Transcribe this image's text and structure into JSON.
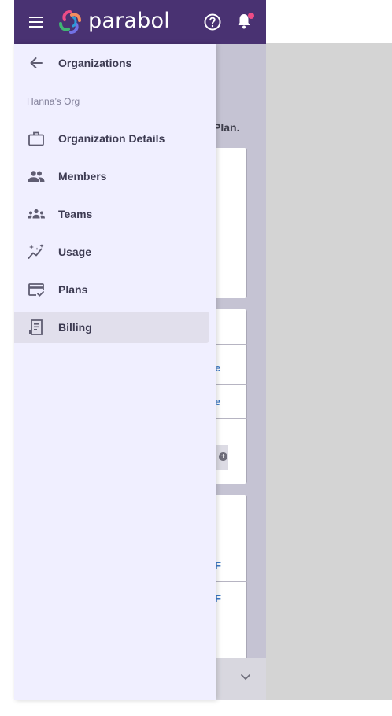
{
  "topbar": {
    "brand": "parabol",
    "menu_icon": "hamburger-menu-icon",
    "help_icon": "help-circle-icon",
    "notifications_icon": "bell-icon",
    "accent": "#493272",
    "notification_dot_color": "#ed4c86"
  },
  "sidebar": {
    "back_label": "Organizations",
    "org_name": "Hanna’s Org",
    "items": [
      {
        "label": "Organization Details",
        "icon": "briefcase-icon"
      },
      {
        "label": "Members",
        "icon": "people-icon"
      },
      {
        "label": "Teams",
        "icon": "groups-icon"
      },
      {
        "label": "Usage",
        "icon": "sparkle-chart-icon"
      },
      {
        "label": "Plans",
        "icon": "card-check-icon"
      },
      {
        "label": "Billing",
        "icon": "receipt-icon",
        "active": true
      }
    ]
  },
  "background": {
    "plan_text": "Plan.",
    "links": [
      "e",
      "e",
      "F",
      "F"
    ],
    "add_symbol": "+"
  }
}
